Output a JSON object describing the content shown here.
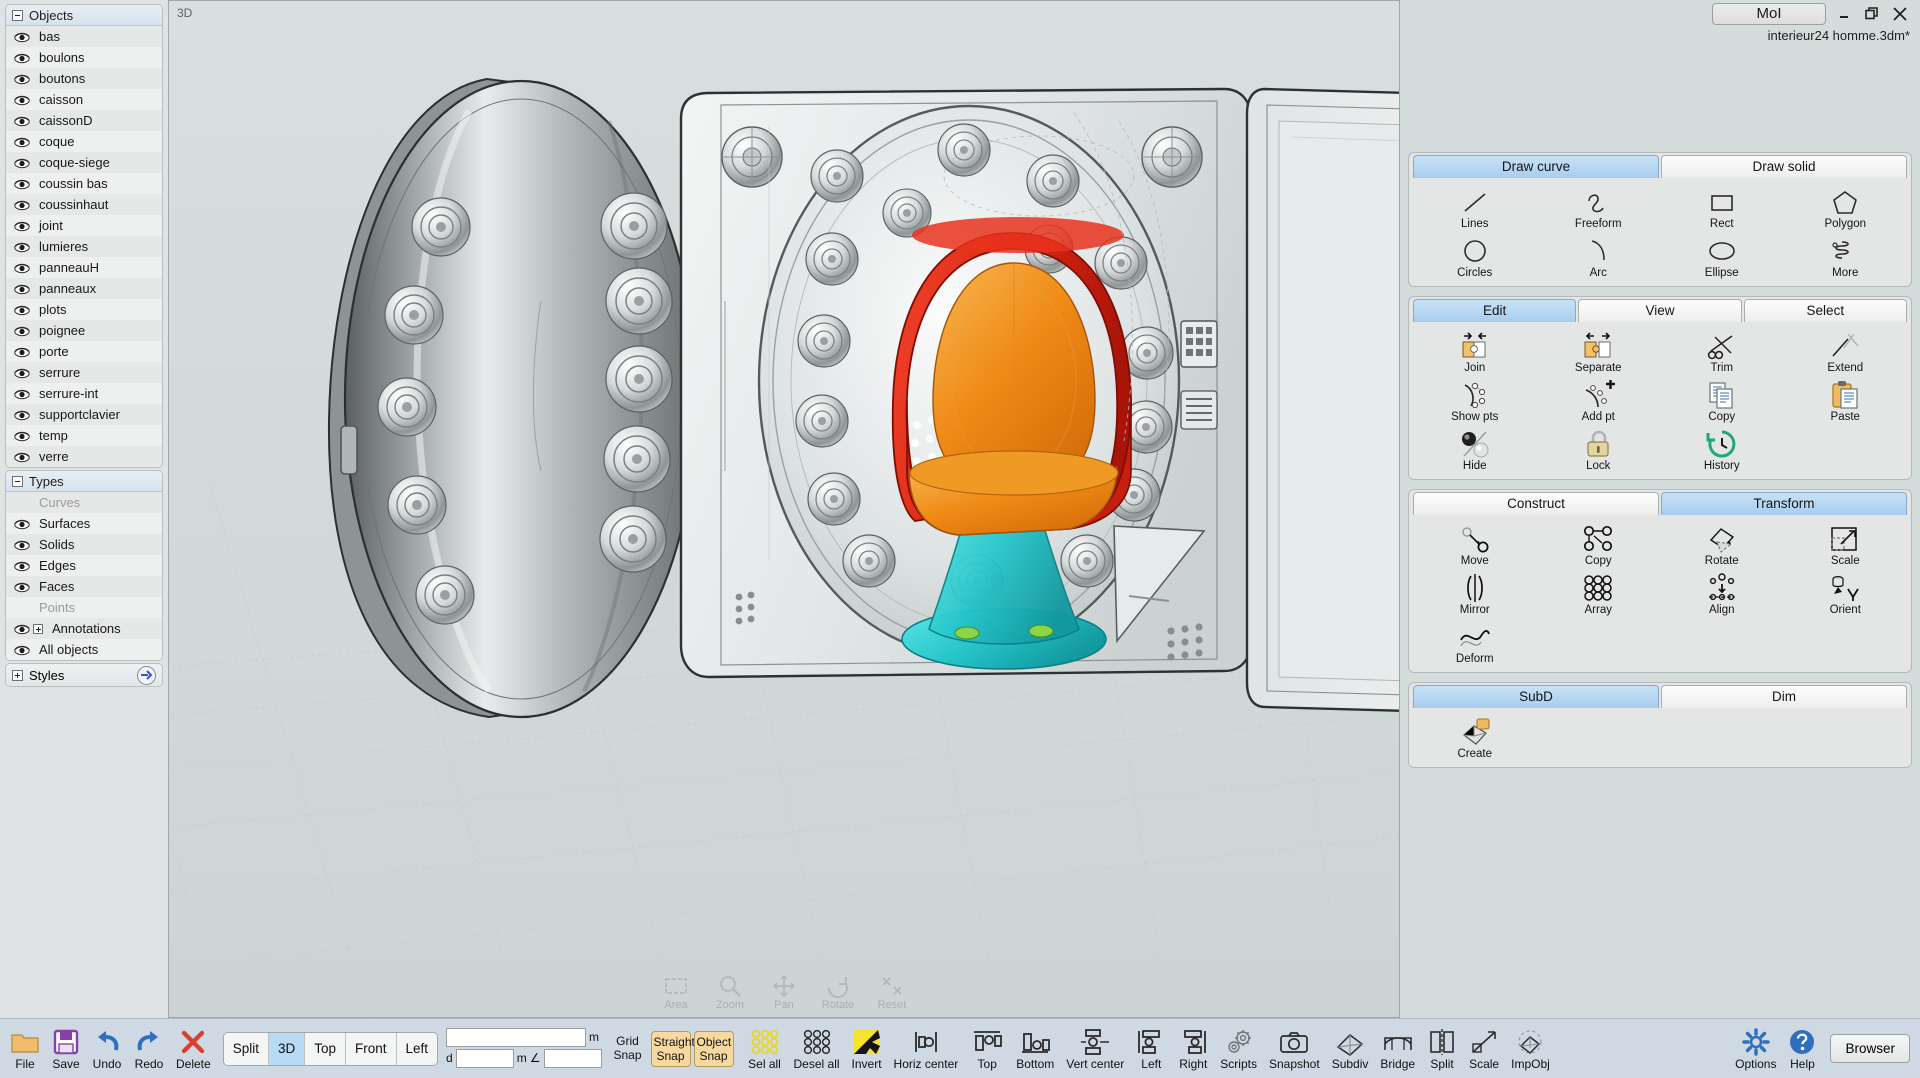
{
  "window": {
    "app_button": "MoI",
    "document_name": "interieur24 homme.3dm*",
    "minimize": "minimize-icon",
    "restore": "restore-icon",
    "close": "close-icon"
  },
  "viewport": {
    "label": "3D",
    "nav": [
      {
        "label": "Area",
        "icon": "area-icon"
      },
      {
        "label": "Zoom",
        "icon": "zoom-icon"
      },
      {
        "label": "Pan",
        "icon": "pan-icon"
      },
      {
        "label": "Rotate",
        "icon": "rotate-icon"
      },
      {
        "label": "Reset",
        "icon": "reset-icon"
      }
    ]
  },
  "sidebar": {
    "objects": {
      "title": "Objects",
      "items": [
        {
          "label": "bas",
          "visible": true
        },
        {
          "label": "boulons",
          "visible": true
        },
        {
          "label": "boutons",
          "visible": true
        },
        {
          "label": "caisson",
          "visible": true
        },
        {
          "label": "caissonD",
          "visible": true
        },
        {
          "label": "coque",
          "visible": true
        },
        {
          "label": "coque-siege",
          "visible": true
        },
        {
          "label": "coussin bas",
          "visible": true
        },
        {
          "label": "coussinhaut",
          "visible": true
        },
        {
          "label": "joint",
          "visible": true
        },
        {
          "label": "lumieres",
          "visible": true
        },
        {
          "label": "panneauH",
          "visible": true
        },
        {
          "label": "panneaux",
          "visible": true
        },
        {
          "label": "plots",
          "visible": true
        },
        {
          "label": "poignee",
          "visible": true
        },
        {
          "label": "porte",
          "visible": true
        },
        {
          "label": "serrure",
          "visible": true
        },
        {
          "label": "serrure-int",
          "visible": true
        },
        {
          "label": "supportclavier",
          "visible": true
        },
        {
          "label": "temp",
          "visible": true
        },
        {
          "label": "verre",
          "visible": true
        }
      ]
    },
    "types": {
      "title": "Types",
      "items": [
        {
          "label": "Curves",
          "visible": false,
          "dim": true
        },
        {
          "label": "Surfaces",
          "visible": true,
          "dim": false
        },
        {
          "label": "Solids",
          "visible": true,
          "dim": false
        },
        {
          "label": "Edges",
          "visible": true,
          "dim": false
        },
        {
          "label": "Faces",
          "visible": true,
          "dim": false
        },
        {
          "label": "Points",
          "visible": false,
          "dim": true
        },
        {
          "label": "Annotations",
          "visible": true,
          "dim": false,
          "expandable": true
        },
        {
          "label": "All objects",
          "visible": true,
          "dim": false
        }
      ]
    },
    "styles": {
      "title": "Styles",
      "arrow": "arrow-right-icon"
    }
  },
  "right_panel": {
    "draw": {
      "tabs": [
        {
          "label": "Draw curve",
          "active": true
        },
        {
          "label": "Draw solid",
          "active": false
        }
      ],
      "tools": [
        {
          "label": "Lines",
          "icon": "line-icon"
        },
        {
          "label": "Freeform",
          "icon": "freeform-curve-icon"
        },
        {
          "label": "Rect",
          "icon": "rectangle-icon"
        },
        {
          "label": "Polygon",
          "icon": "polygon-icon"
        },
        {
          "label": "Circles",
          "icon": "circle-icon"
        },
        {
          "label": "Arc",
          "icon": "arc-icon"
        },
        {
          "label": "Ellipse",
          "icon": "ellipse-icon"
        },
        {
          "label": "More",
          "icon": "helix-more-icon"
        }
      ]
    },
    "edit": {
      "tabs": [
        {
          "label": "Edit",
          "active": true
        },
        {
          "label": "View",
          "active": false
        },
        {
          "label": "Select",
          "active": false
        }
      ],
      "tools": [
        {
          "label": "Join",
          "icon": "join-icon"
        },
        {
          "label": "Separate",
          "icon": "separate-icon"
        },
        {
          "label": "Trim",
          "icon": "scissors-trim-icon"
        },
        {
          "label": "Extend",
          "icon": "extend-icon"
        },
        {
          "label": "Show pts",
          "icon": "show-points-icon"
        },
        {
          "label": "Add pt",
          "icon": "add-point-icon"
        },
        {
          "label": "Copy",
          "icon": "copy-icon"
        },
        {
          "label": "Paste",
          "icon": "paste-icon"
        },
        {
          "label": "Hide",
          "icon": "hide-sphere-icon"
        },
        {
          "label": "Lock",
          "icon": "padlock-icon"
        },
        {
          "label": "History",
          "icon": "history-clock-icon"
        }
      ]
    },
    "transform": {
      "tabs": [
        {
          "label": "Construct",
          "active": false
        },
        {
          "label": "Transform",
          "active": true
        }
      ],
      "tools": [
        {
          "label": "Move",
          "icon": "move-icon"
        },
        {
          "label": "Copy",
          "icon": "copy-transform-icon"
        },
        {
          "label": "Rotate",
          "icon": "rotate-shape-icon"
        },
        {
          "label": "Scale",
          "icon": "scale-icon"
        },
        {
          "label": "Mirror",
          "icon": "mirror-icon"
        },
        {
          "label": "Array",
          "icon": "array-icon"
        },
        {
          "label": "Align",
          "icon": "align-icon"
        },
        {
          "label": "Orient",
          "icon": "orient-icon"
        },
        {
          "label": "Deform",
          "icon": "deform-icon"
        }
      ]
    },
    "subd": {
      "tabs": [
        {
          "label": "SubD",
          "active": true
        },
        {
          "label": "Dim",
          "active": false
        }
      ],
      "tools": [
        {
          "label": "Create",
          "icon": "create-subd-icon"
        }
      ]
    },
    "browser_button": "Browser"
  },
  "bottom_bar": {
    "commands": [
      {
        "label": "File",
        "icon": "folder-icon"
      },
      {
        "label": "Save",
        "icon": "floppy-save-icon"
      },
      {
        "label": "Undo",
        "icon": "undo-arrow-icon"
      },
      {
        "label": "Redo",
        "icon": "redo-arrow-icon"
      },
      {
        "label": "Delete",
        "icon": "delete-x-icon"
      }
    ],
    "views": [
      {
        "label": "Split",
        "active": false
      },
      {
        "label": "3D",
        "active": true
      },
      {
        "label": "Top",
        "active": false
      },
      {
        "label": "Front",
        "active": false
      },
      {
        "label": "Left",
        "active": false
      }
    ],
    "coords": {
      "main_value": "",
      "main_unit": "m",
      "d_label": "d",
      "d_value": "",
      "d_unit": "m",
      "angle_label": "∠",
      "angle_value": ""
    },
    "snaps": [
      {
        "label_top": "Grid",
        "label_bottom": "Snap",
        "active": false
      },
      {
        "label_top": "Straight",
        "label_bottom": "Snap",
        "active": true
      },
      {
        "label_top": "Object",
        "label_bottom": "Snap",
        "active": true
      }
    ],
    "selection": [
      {
        "label": "Sel all",
        "icon": "select-all-icon"
      },
      {
        "label": "Desel all",
        "icon": "deselect-all-icon"
      },
      {
        "label": "Invert",
        "icon": "invert-selection-icon"
      }
    ],
    "align": [
      {
        "label": "Horiz center",
        "icon": "align-horiz-center-icon"
      },
      {
        "label": "Top",
        "icon": "align-top-icon"
      },
      {
        "label": "Bottom",
        "icon": "align-bottom-icon"
      },
      {
        "label": "Vert center",
        "icon": "align-vert-center-icon"
      },
      {
        "label": "Left",
        "icon": "align-left-icon"
      },
      {
        "label": "Right",
        "icon": "align-right-icon"
      }
    ],
    "extras": [
      {
        "label": "Scripts",
        "icon": "gears-scripts-icon"
      },
      {
        "label": "Snapshot",
        "icon": "camera-icon"
      },
      {
        "label": "Subdiv",
        "icon": "subdiv-icon"
      },
      {
        "label": "Bridge",
        "icon": "bridge-icon"
      },
      {
        "label": "Split",
        "icon": "split-icon"
      },
      {
        "label": "Scale",
        "icon": "scale-bottom-icon"
      },
      {
        "label": "ImpObj",
        "icon": "import-object-icon"
      }
    ],
    "right": [
      {
        "label": "Options",
        "icon": "options-gear-icon"
      },
      {
        "label": "Help",
        "icon": "help-question-icon"
      }
    ],
    "browser": "Browser"
  },
  "colors": {
    "accent_blue": "#a9cdef",
    "snap_orange": "#f7d9a0",
    "bottom_bar": "#cfd9e4",
    "panel_bg": "#e4e6e6",
    "chair_red": "#e02b1a",
    "chair_orange": "#ef8a16",
    "chair_teal": "#2ec8cc"
  }
}
